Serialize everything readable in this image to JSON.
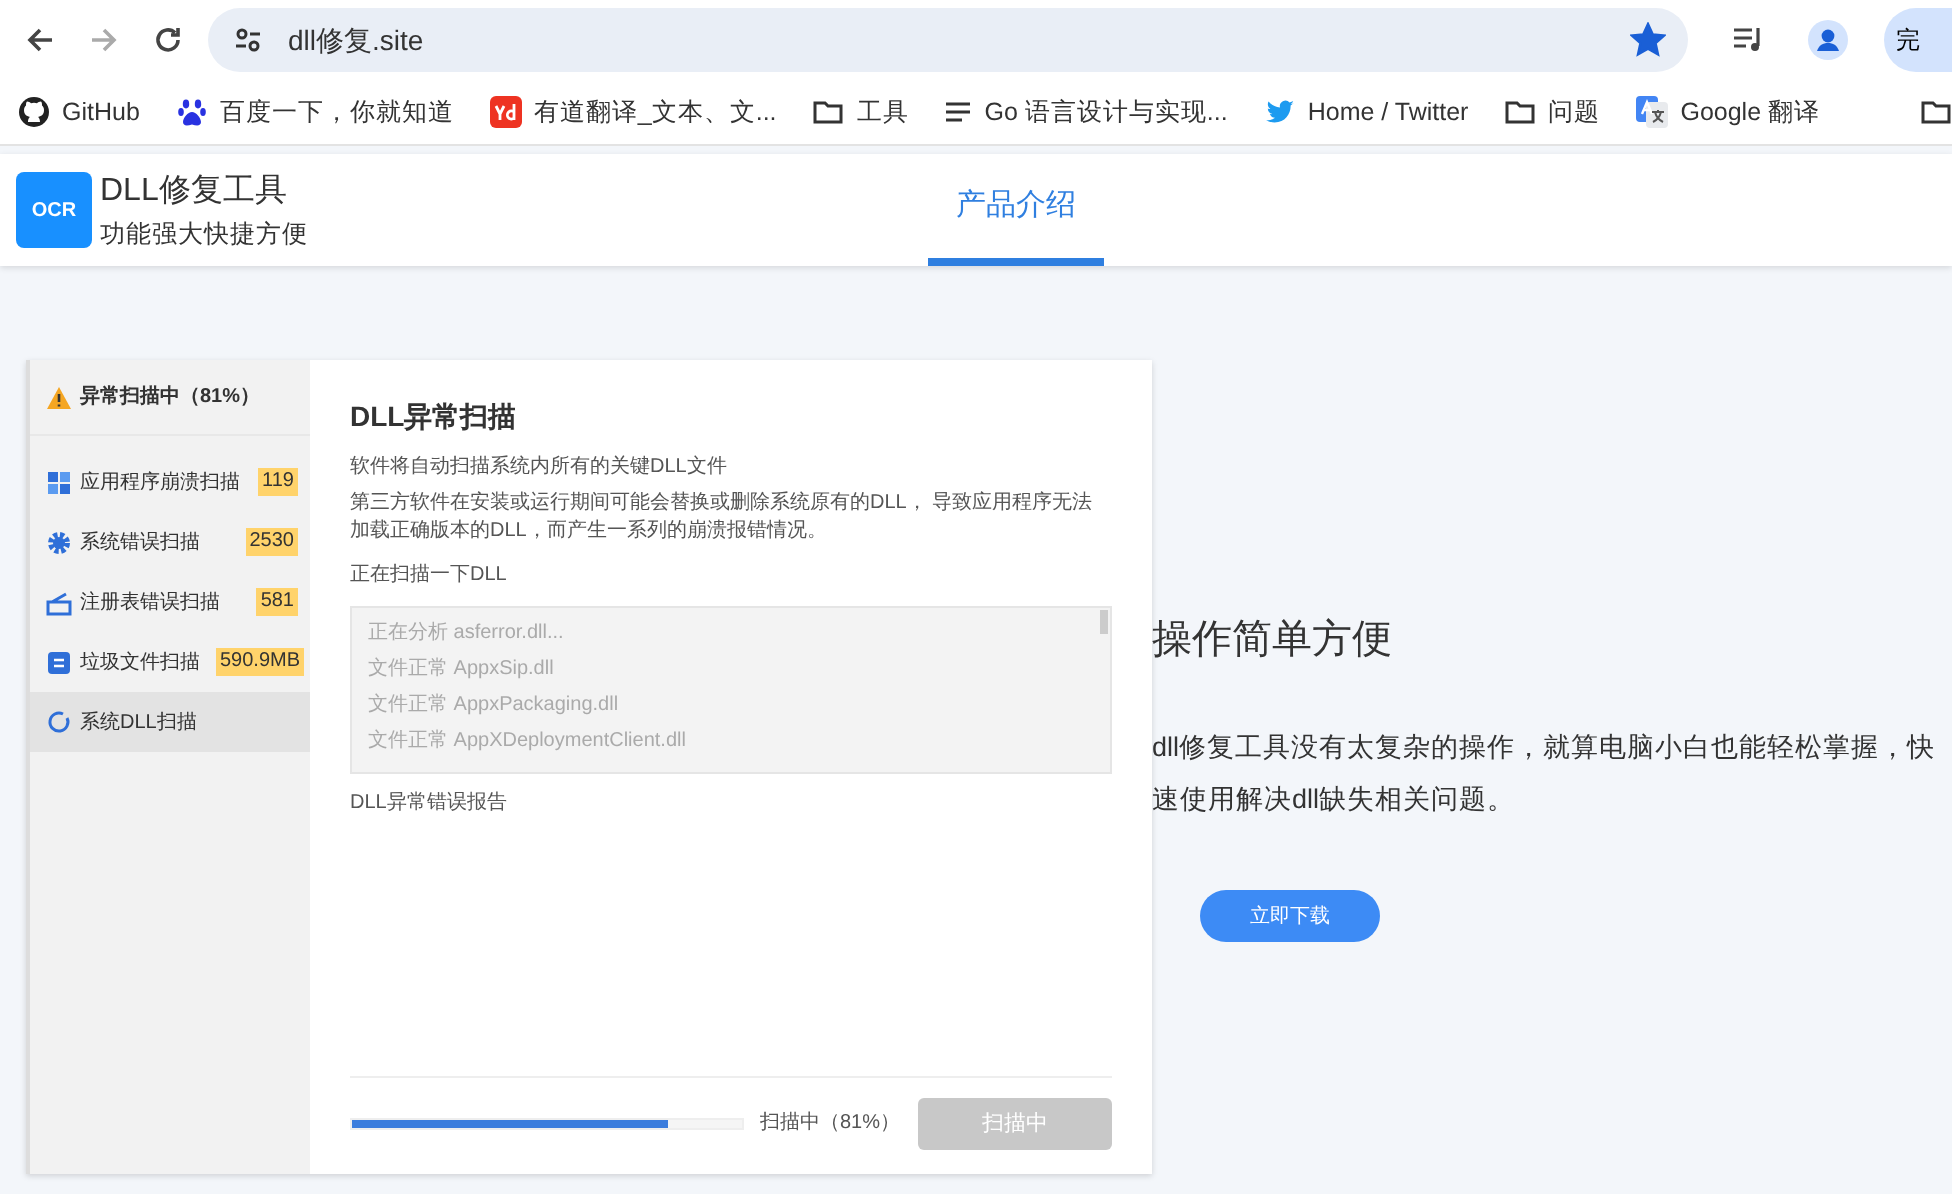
{
  "browser": {
    "url": "dll修复.site",
    "bookmarked": true,
    "profile_button": "完",
    "bookmarks": [
      {
        "kind": "github",
        "label": "GitHub"
      },
      {
        "kind": "paw",
        "label": "百度一下，你就知道"
      },
      {
        "kind": "yd",
        "label": "有道翻译_文本、文..."
      },
      {
        "kind": "folder",
        "label": "工具"
      },
      {
        "kind": "lines",
        "label": "Go 语言设计与实现..."
      },
      {
        "kind": "bird",
        "label": "Home / Twitter"
      },
      {
        "kind": "folder",
        "label": "问题"
      },
      {
        "kind": "translate",
        "label": "Google 翻译"
      }
    ]
  },
  "site_header": {
    "logo": "OCR",
    "title": "DLL修复工具",
    "subtitle": "功能强大快捷方便",
    "nav": [
      {
        "label": "产品介绍",
        "selected": true
      }
    ]
  },
  "app": {
    "sidebar": {
      "header": "异常扫描中（81%）",
      "items": [
        {
          "kind": "apps",
          "label": "应用程序崩溃扫描",
          "count": "119",
          "selected": false
        },
        {
          "kind": "gear",
          "label": "系统错误扫描",
          "count": "2530",
          "selected": false
        },
        {
          "kind": "registry",
          "label": "注册表错误扫描",
          "count": "581",
          "selected": false
        },
        {
          "kind": "trash",
          "label": "垃圾文件扫描",
          "count": "590.9MB",
          "selected": false
        },
        {
          "kind": "refresh",
          "label": "系统DLL扫描",
          "selected": true
        }
      ]
    },
    "content": {
      "title": "DLL异常扫描",
      "intro": "软件将自动扫描系统内所有的关键DLL文件",
      "description": "第三方软件在安装或运行期间可能会替换或删除系统原有的DLL， 导致应用程序无法加载正确版本的DLL，而产生一系列的崩溃报错情况。",
      "scan_label": "正在扫描一下DLL",
      "log": [
        "正在分析 asferror.dll...",
        "文件正常 AppxSip.dll",
        "文件正常 AppxPackaging.dll",
        "文件正常 AppXDeploymentClient.dll"
      ],
      "report_label": "DLL异常错误报告",
      "progress": {
        "level": 0.81,
        "reading": "扫描中（81%）"
      },
      "scan_button": {
        "label": "扫描中",
        "disabled": true
      }
    }
  },
  "feature": {
    "title": "操作简单方便",
    "body": "dll修复工具没有太复杂的操作，就算电脑小白也能轻松掌握，快速使用解决dll缺失相关问题。",
    "button": "立即下载"
  }
}
